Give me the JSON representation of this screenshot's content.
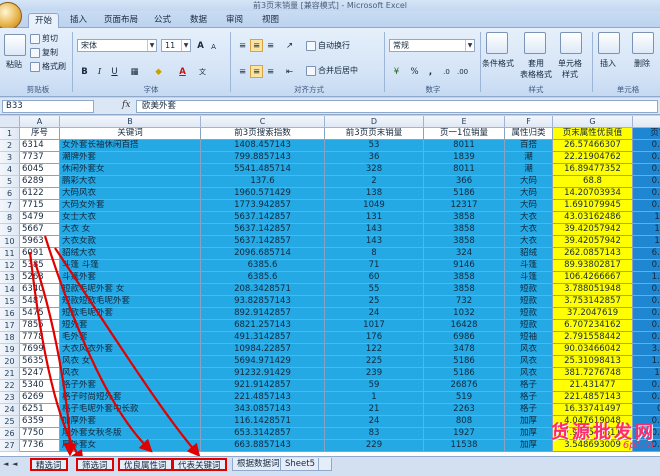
{
  "window": {
    "title": "前3页末销量 [兼容模式] - Microsoft Excel"
  },
  "ribbon_tabs": [
    "开始",
    "插入",
    "页面布局",
    "公式",
    "数据",
    "审阅",
    "视图"
  ],
  "clipboard": {
    "paste": "粘贴",
    "cut": "剪切",
    "copy": "复制",
    "painter": "格式刷",
    "label": "剪贴板"
  },
  "font": {
    "name": "宋体",
    "size": "11",
    "bold": "B",
    "italic": "I",
    "underline": "U",
    "increase": "A",
    "decrease": "A",
    "label": "字体"
  },
  "alignment": {
    "wrap": "自动换行",
    "merge": "合并后居中",
    "label": "对齐方式"
  },
  "number": {
    "format": "常规",
    "percent": "%",
    "comma": ",",
    "label": "数字"
  },
  "styles": {
    "cond": "条件格式",
    "table": "套用\n表格格式",
    "cellstyle": "单元格\n样式",
    "label": "样式"
  },
  "cells": {
    "insert": "插入",
    "delete": "删除",
    "label": "单元格"
  },
  "formula_bar": {
    "namebox": "B33",
    "fx": "fx",
    "content": "欧美外套"
  },
  "columns": [
    "A",
    "B",
    "C",
    "D",
    "E",
    "F",
    "G",
    "H"
  ],
  "headers": [
    "序号",
    "关键词",
    "前3页搜索指数",
    "前3页页末销量",
    "页一1位销量",
    "属性归类",
    "页末属性优良值",
    "页首属性优良值"
  ],
  "rows": [
    [
      "6314",
      "女外套长袖休闲百搭",
      "1408.457143",
      "53",
      "8011",
      "百搭",
      "26.57466307",
      "0.175815397"
    ],
    [
      "7737",
      "潮牌外套",
      "799.8857143",
      "36",
      "1839",
      "潮",
      "22.21904762",
      "0.434956887"
    ],
    [
      "6045",
      "休闲外套女",
      "5541.485714",
      "328",
      "8011",
      "潮",
      "16.89477352",
      "0.691734579"
    ],
    [
      "6289",
      "鹏彩大衣",
      "137.6",
      "2",
      "366",
      "大码",
      "68.8",
      "0.375956284"
    ],
    [
      "6122",
      "大码风衣",
      "1960.571429",
      "138",
      "5186",
      "大码",
      "14.20703934",
      "0.378050796"
    ],
    [
      "7715",
      "大码女外套",
      "1773.942857",
      "1049",
      "12317",
      "大码",
      "1.691079945",
      "0.144022933"
    ],
    [
      "5479",
      "女士大衣",
      "5637.142857",
      "131",
      "3858",
      "大衣",
      "43.03162486",
      "1.46115678"
    ],
    [
      "5667",
      "大衣 女",
      "5637.142857",
      "143",
      "3858",
      "大衣",
      "39.42057942",
      "1.46115678"
    ],
    [
      "5963",
      "大衣女款",
      "5637.142857",
      "143",
      "3858",
      "大衣",
      "39.42057942",
      "1.46115678"
    ],
    [
      "6091",
      "貂绒大衣",
      "2096.685714",
      "8",
      "324",
      "貂绒",
      "262.0857143",
      "6.471252205"
    ],
    [
      "5385",
      "斗篷 斗篷",
      "6385.6",
      "71",
      "9146",
      "斗篷",
      "89.93802817",
      "0.698184999"
    ],
    [
      "5263",
      "斗篷外套",
      "6385.6",
      "60",
      "3858",
      "斗篷",
      "106.4266667",
      "1.655158113"
    ],
    [
      "6340",
      "短款毛呢外套 女",
      "208.3428571",
      "55",
      "3858",
      "短款",
      "3.788051948",
      "0.054002814"
    ],
    [
      "5487",
      "短款短款毛呢外套",
      "93.82857143",
      "25",
      "732",
      "短款",
      "3.753142857",
      "0.128181109"
    ],
    [
      "5475",
      "短款毛呢外套",
      "892.9142857",
      "24",
      "1032",
      "短款",
      "37.2047619",
      "0.865227021"
    ],
    [
      "7855",
      "短外套",
      "6821.257143",
      "1017",
      "16428",
      "短款",
      "6.707234162",
      "0.415221399"
    ],
    [
      "7778",
      "毛外套",
      "491.3142857",
      "176",
      "6986",
      "短袖",
      "2.791558442",
      "0.070328412"
    ],
    [
      "7699",
      "大衣风衣外套",
      "10984.22857",
      "122",
      "3478",
      "风衣",
      "90.03466042",
      "3.158202579"
    ],
    [
      "5635",
      "风衣 女",
      "5694.971429",
      "225",
      "5186",
      "风衣",
      "25.31098413",
      "1.098143353"
    ],
    [
      "5247",
      "风衣",
      "91232.91429",
      "239",
      "5186",
      "风衣",
      "381.7276748",
      "17.5921547"
    ],
    [
      "5340",
      "格子外套",
      "921.9142857",
      "59",
      "26876",
      "格子",
      "21.431477",
      "0.047047817"
    ],
    [
      "6269",
      "格子时尚短外套",
      "221.4857143",
      "1",
      "519",
      "格子",
      "221.4857143",
      "0.426754748"
    ],
    [
      "6251",
      "格子毛呢外套中长款",
      "343.0857143",
      "21",
      "2263",
      "格子",
      "16.33741497",
      "0.1516059"
    ],
    [
      "6359",
      "加厚外套",
      "116.1428571",
      "24",
      "808",
      "加厚",
      "4.047619048",
      "0.143741158"
    ],
    [
      "7750",
      "厚外套女秋冬版",
      "653.3142857",
      "83",
      "1927",
      "加厚",
      "7.943545611",
      "0.339032883"
    ],
    [
      "7736",
      "厚外套女",
      "663.8857143",
      "229",
      "11538",
      "加厚",
      "3.548693009",
      "0.057538751"
    ]
  ],
  "sheet_tabs": [
    "精选词",
    "筛选词",
    "优良属性词",
    "代表关键词",
    "根据数据词",
    "Sheet5"
  ],
  "watermark": {
    "main": "货源批发网",
    "sub": "6pf.cn"
  }
}
